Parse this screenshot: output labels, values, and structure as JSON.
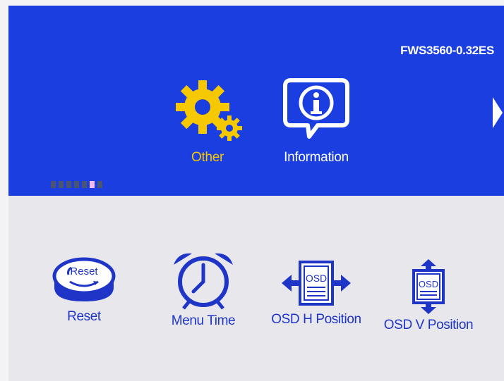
{
  "header": {
    "model": "FWS3560-0.32ES"
  },
  "main_menu": {
    "items": [
      {
        "label": "Other",
        "icon": "gears-icon",
        "selected": true
      },
      {
        "label": "Information",
        "icon": "info-icon",
        "selected": false
      }
    ],
    "next_icon": "arrow-right-icon",
    "page_indicator": {
      "pages": 7,
      "current": 6
    }
  },
  "submenu": {
    "items": [
      {
        "label": "Reset",
        "icon": "reset-icon"
      },
      {
        "label": "Menu Time",
        "icon": "alarm-clock-icon"
      },
      {
        "label": "OSD H Position",
        "icon": "osd-h-position-icon"
      },
      {
        "label": "OSD V Position",
        "icon": "osd-v-position-icon"
      }
    ]
  },
  "colors": {
    "panel_blue": "#1a3ee0",
    "selected_yellow": "#f5c800",
    "submenu_text": "#1e35c8",
    "submenu_bg": "#e8e8ec",
    "active_dot": "#f7b8ee"
  }
}
